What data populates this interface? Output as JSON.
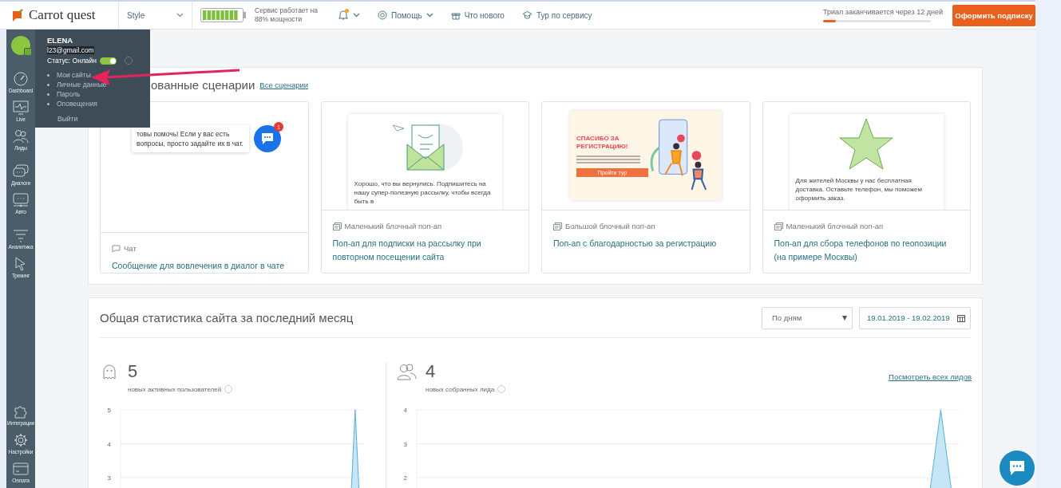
{
  "topbar": {
    "logo": "Carrot quest",
    "project_select": "Style",
    "service_status": "Сервис работает на 88% мощности",
    "nav": [
      {
        "kind": "notifications",
        "unread": true,
        "dropdown": true
      },
      {
        "kind": "help",
        "label": "Помощь",
        "dropdown": true
      },
      {
        "kind": "news",
        "label": "Что нового",
        "dropdown": false
      },
      {
        "kind": "tour",
        "label": "Тур по сервису",
        "dropdown": false
      }
    ],
    "trial": {
      "text": "Триал заканчивается через 12 дней",
      "level": 0.12
    },
    "subscribe_button": "Оформить подписку"
  },
  "sidebar": {
    "items": [
      {
        "kind": "dashboard",
        "label": "Dashboard"
      },
      {
        "kind": "live",
        "label": "Live"
      },
      {
        "kind": "leads",
        "label": "Лиды"
      },
      {
        "kind": "dialogs",
        "label": "Диалоги"
      },
      {
        "kind": "auto",
        "label": "Авто"
      },
      {
        "kind": "analytics",
        "label": "Аналитика"
      },
      {
        "kind": "tracking",
        "label": "Трекинг"
      }
    ],
    "bottom_items": [
      {
        "kind": "integrations",
        "label": "Интеграции"
      },
      {
        "kind": "settings",
        "label": "Настройки"
      },
      {
        "kind": "payment",
        "label": "Оплата"
      }
    ]
  },
  "profile_menu": {
    "name": "ELENA",
    "email": "l23@gmail.com",
    "status_label": "Статус: Онлайн",
    "online": true,
    "items": [
      "Мои сайты",
      "Личные данные",
      "Пароль",
      "Оповещения"
    ],
    "logout": "Выйти"
  },
  "scenarios": {
    "title": "ованные сценарии",
    "all_link": "Все сценарии",
    "cards": [
      {
        "kind": "chat",
        "preview_text": "товы помочь! Если у вас есть вопросы, просто задайте их в чат.",
        "badge": "1",
        "type": "Чат",
        "title": "Сообщение для вовлечения в диалог в чате"
      },
      {
        "kind": "subscribe_popup",
        "preview_text": "Хорошо, что вы вернулись. Подпишитесь на нашу супер-полезную рассылку, чтобы всегда быть в",
        "type": "Маленький блочный поп-ап",
        "title": "Поп-ап для подписки на рассылку при повторном посещении сайта"
      },
      {
        "kind": "thanks_popup",
        "preview_title": "СПАСИБО ЗА РЕГИСТРАЦИЮ!",
        "preview_button": "Пройти тур",
        "type": "Большой блочный поп-ап",
        "title": "Поп-ап с благодарностью за регистрацию"
      },
      {
        "kind": "geo_popup",
        "preview_text": "Для жителей Москвы у нас бесплатная доставка. Оставьте телефон, мы поможем оформить заказ.",
        "type": "Маленький блочный поп-ап",
        "title": "Поп-ап для сбора телефонов по геопозиции (на примере Москвы)"
      }
    ]
  },
  "stats": {
    "title": "Общая статистика сайта за последний месяц",
    "period_select": "По дням",
    "date_range": "19.01.2019 - 19.02.2019",
    "metrics": [
      {
        "kind": "users",
        "value": "5",
        "label": "новых активных пользователей",
        "chart_data": {
          "type": "area",
          "ylim": [
            0,
            5
          ],
          "yticks": [
            5,
            4,
            3
          ],
          "values": [
            0,
            0,
            0,
            0,
            0,
            0,
            0,
            0,
            0,
            0,
            0,
            0,
            0,
            0,
            0,
            0,
            0,
            0,
            0,
            0,
            0,
            0,
            0,
            0,
            0,
            0,
            0,
            0,
            0,
            5,
            0
          ]
        }
      },
      {
        "kind": "leads",
        "value": "4",
        "label": "новых собранных лида",
        "link": "Посмотреть всех лидов",
        "chart_data": {
          "type": "area",
          "ylim": [
            0,
            4
          ],
          "yticks": [
            4,
            3,
            2
          ],
          "values": [
            0,
            0,
            0,
            0,
            0,
            0,
            0,
            0,
            0,
            0,
            0,
            0,
            0,
            0,
            0,
            0,
            0,
            0,
            0,
            0,
            0,
            0,
            0,
            0,
            0,
            0,
            0,
            0,
            0,
            4,
            0
          ]
        }
      }
    ]
  }
}
